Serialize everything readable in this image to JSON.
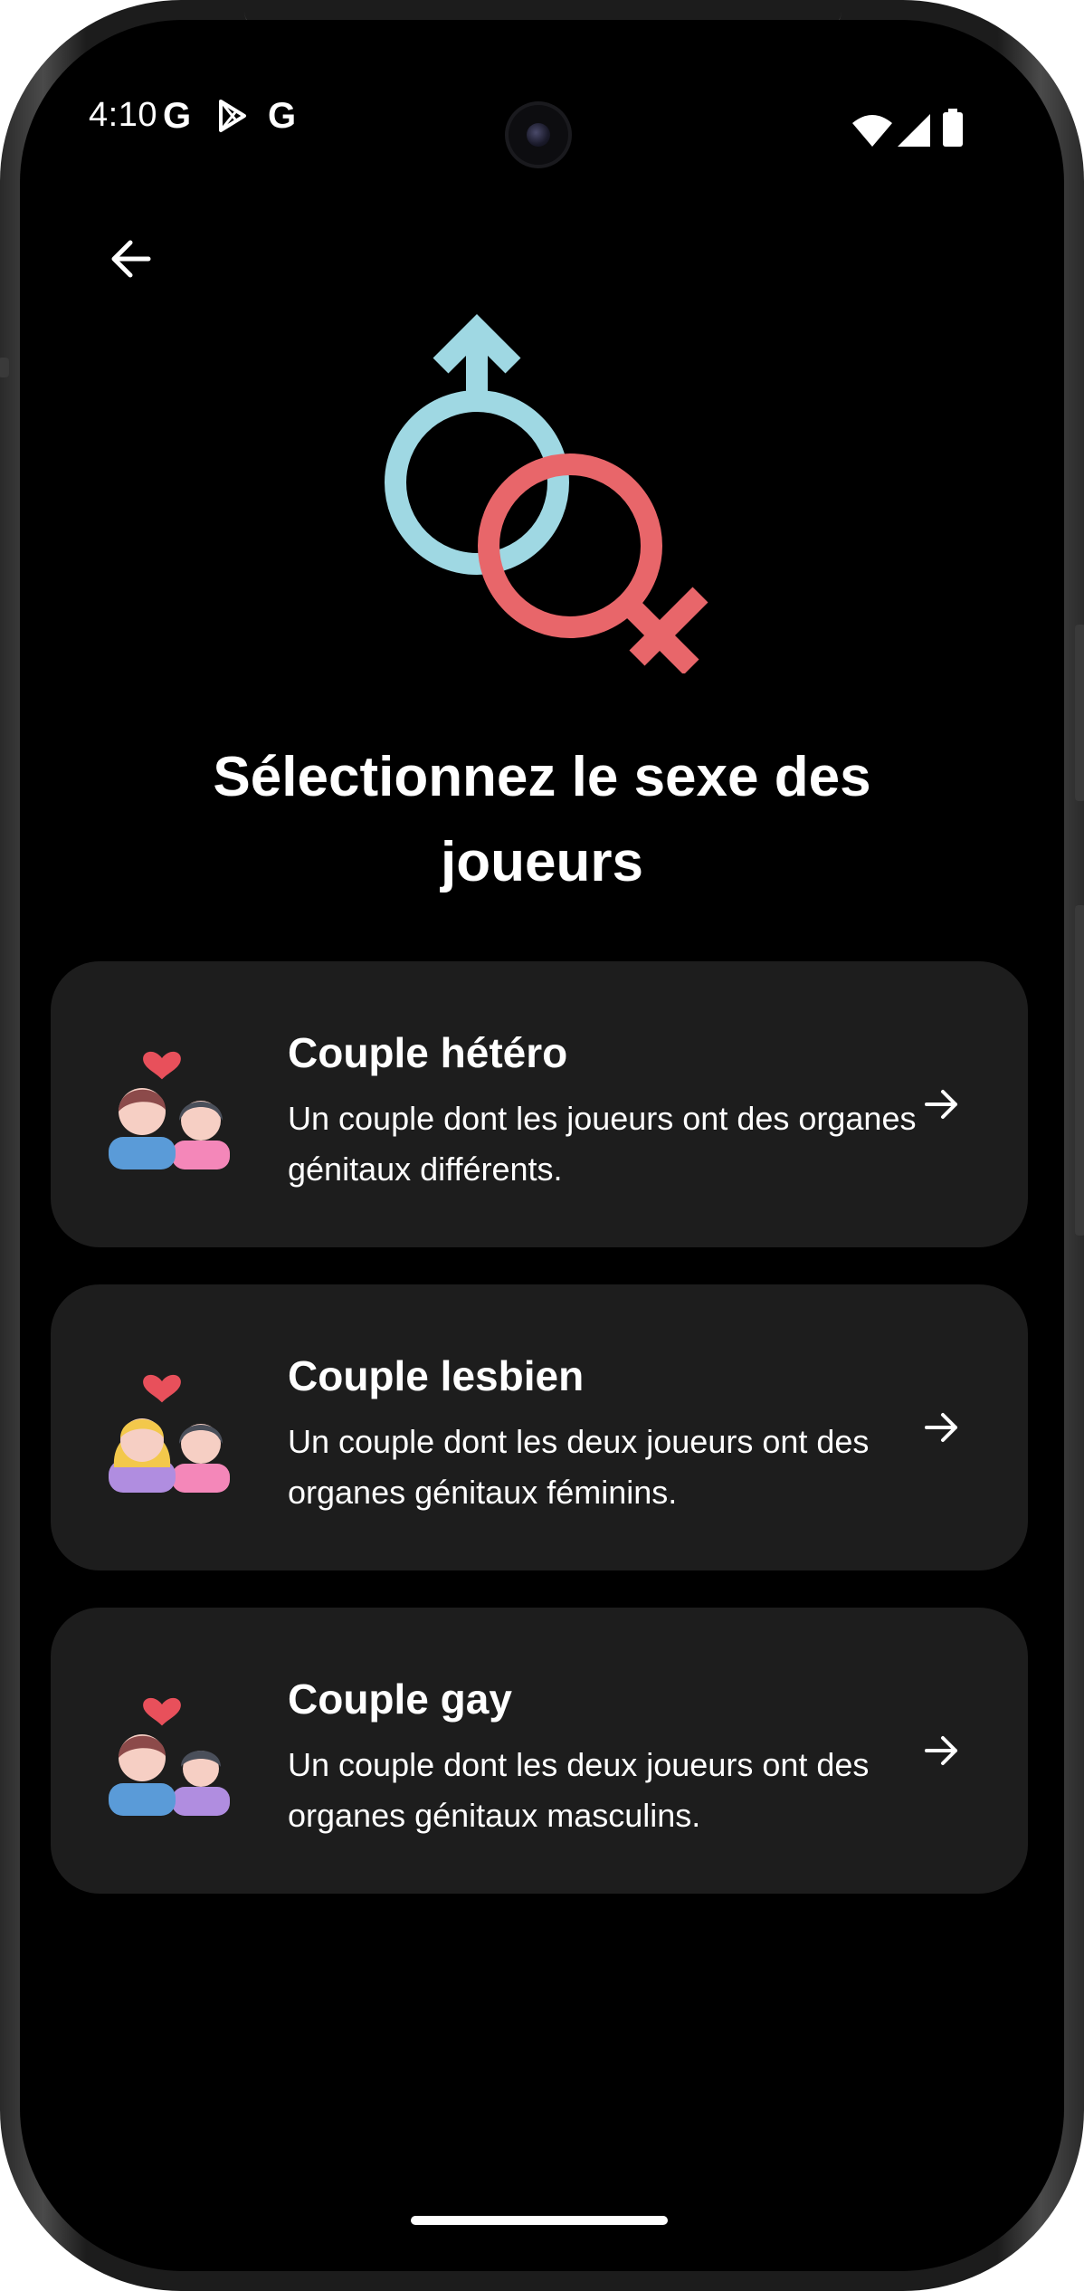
{
  "status_bar": {
    "time": "4:10",
    "notification_icons": [
      "google-icon",
      "play-store-icon",
      "google-icon"
    ],
    "notification_g": "G",
    "right_icons": [
      "wifi-icon",
      "signal-icon",
      "battery-icon"
    ]
  },
  "header": {
    "back_icon": "arrow-left-icon",
    "hero_icon": "gender-symbols-icon"
  },
  "title": "Sélectionnez le sexe des joueurs",
  "options": [
    {
      "title": "Couple hétéro",
      "description": "Un couple dont les joueurs ont des organes génitaux différents.",
      "icon": "hetero-couple-icon"
    },
    {
      "title": "Couple lesbien",
      "description": "Un couple dont les deux joueurs ont des organes génitaux féminins.",
      "icon": "lesbian-couple-icon"
    },
    {
      "title": "Couple gay",
      "description": "Un couple dont les deux joueurs ont des organes génitaux masculins.",
      "icon": "gay-couple-icon"
    }
  ],
  "colors": {
    "background": "#000000",
    "card": "#1d1d1d",
    "male_symbol": "#9fd8e3",
    "female_symbol": "#e8666a",
    "text": "#ffffff"
  }
}
